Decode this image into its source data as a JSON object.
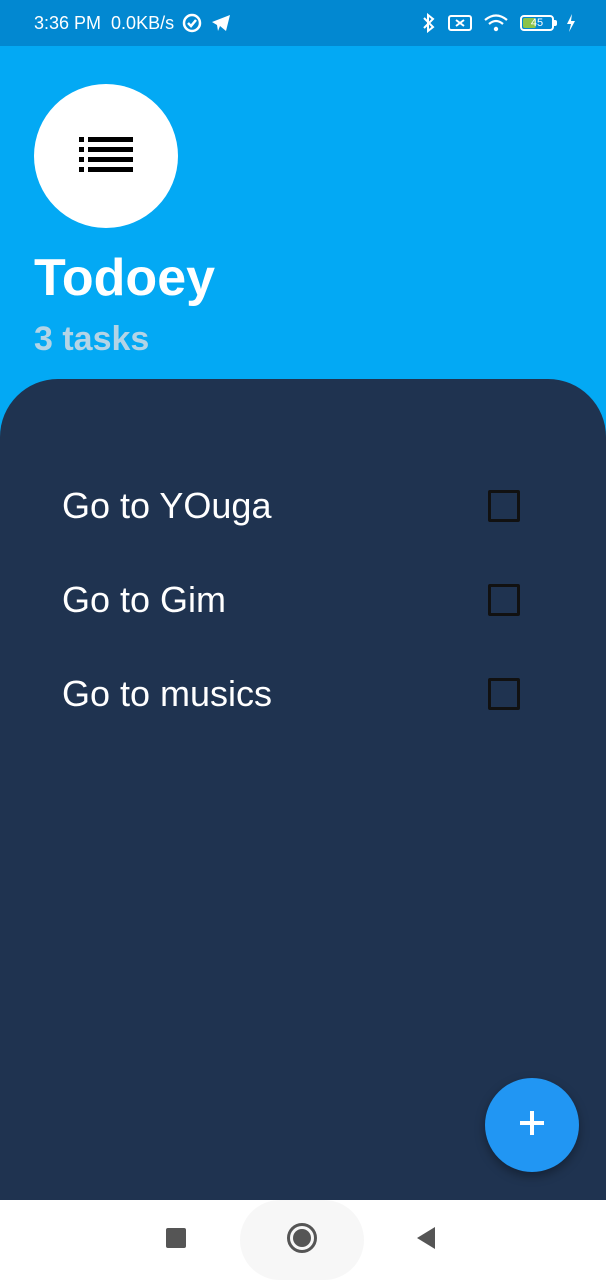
{
  "status_bar": {
    "time": "3:36 PM",
    "network_speed": "0.0KB/s",
    "left_icons": [
      "vpn-icon",
      "telegram-icon"
    ],
    "right_icons": [
      "bluetooth-icon",
      "sim-off-icon",
      "wifi-icon",
      "battery-icon",
      "charging-icon"
    ],
    "battery_level": "45"
  },
  "header": {
    "logo_icon": "list-icon",
    "title": "Todoey",
    "task_count": "3 tasks"
  },
  "tasks": [
    {
      "label": "Go to YOuga",
      "checked": false
    },
    {
      "label": "Go to Gim",
      "checked": false
    },
    {
      "label": "Go to musics",
      "checked": false
    }
  ],
  "fab": {
    "icon": "plus-icon"
  },
  "nav_bar": {
    "buttons": [
      "recents-button",
      "home-button",
      "back-button"
    ]
  },
  "colors": {
    "header_bg": "#03A9F4",
    "status_bar_bg": "#0288D1",
    "panel_bg": "#1F3350",
    "fab_bg": "#2196F3",
    "task_count_text": "#B3D4E6"
  }
}
